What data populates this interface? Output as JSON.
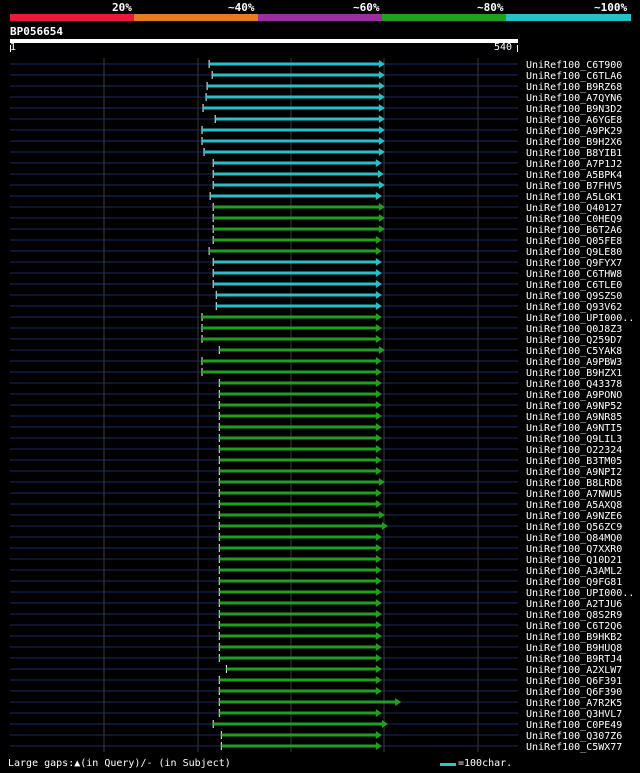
{
  "legend": {
    "labels": [
      "20%",
      "~40%",
      "~60%",
      "~80%",
      "~100%"
    ],
    "colors": [
      "#e8193c",
      "#e87b1e",
      "#9b2fa2",
      "#1fa01f",
      "#27bfc9"
    ]
  },
  "query": {
    "name": "BP056654",
    "start": "1",
    "end": "540"
  },
  "hits": [
    {
      "id": "UniRef100_C6T900",
      "s": 0.392,
      "e": 0.736,
      "c": "#27bfc9"
    },
    {
      "id": "UniRef100_C6TLA6",
      "s": 0.398,
      "e": 0.736,
      "c": "#27bfc9"
    },
    {
      "id": "UniRef100_B9RZ68",
      "s": 0.388,
      "e": 0.736,
      "c": "#27bfc9"
    },
    {
      "id": "UniRef100_A7QYN6",
      "s": 0.386,
      "e": 0.736,
      "c": "#27bfc9"
    },
    {
      "id": "UniRef100_B9N3D2",
      "s": 0.38,
      "e": 0.736,
      "c": "#27bfc9"
    },
    {
      "id": "UniRef100_A6YGE8",
      "s": 0.404,
      "e": 0.736,
      "c": "#27bfc9"
    },
    {
      "id": "UniRef100_A9PK29",
      "s": 0.378,
      "e": 0.736,
      "c": "#27bfc9"
    },
    {
      "id": "UniRef100_B9H2X6",
      "s": 0.378,
      "e": 0.736,
      "c": "#27bfc9"
    },
    {
      "id": "UniRef100_B8YIB1",
      "s": 0.382,
      "e": 0.736,
      "c": "#27bfc9"
    },
    {
      "id": "UniRef100_A7P1J2",
      "s": 0.4,
      "e": 0.73,
      "c": "#27bfc9"
    },
    {
      "id": "UniRef100_A5BPK4",
      "s": 0.4,
      "e": 0.734,
      "c": "#27bfc9"
    },
    {
      "id": "UniRef100_B7FHV5",
      "s": 0.4,
      "e": 0.736,
      "c": "#27bfc9"
    },
    {
      "id": "UniRef100_A5LGK1",
      "s": 0.394,
      "e": 0.73,
      "c": "#27bfc9"
    },
    {
      "id": "UniRef100_Q40127",
      "s": 0.4,
      "e": 0.736,
      "c": "#1fa01f"
    },
    {
      "id": "UniRef100_C0HEQ9",
      "s": 0.4,
      "e": 0.736,
      "c": "#1fa01f"
    },
    {
      "id": "UniRef100_B6T2A6",
      "s": 0.4,
      "e": 0.736,
      "c": "#1fa01f"
    },
    {
      "id": "UniRef100_Q05FE8",
      "s": 0.4,
      "e": 0.73,
      "c": "#1fa01f"
    },
    {
      "id": "UniRef100_Q9LE80",
      "s": 0.392,
      "e": 0.73,
      "c": "#1fa01f"
    },
    {
      "id": "UniRef100_Q9FYX7",
      "s": 0.4,
      "e": 0.73,
      "c": "#27bfc9"
    },
    {
      "id": "UniRef100_C6THW8",
      "s": 0.4,
      "e": 0.73,
      "c": "#27bfc9"
    },
    {
      "id": "UniRef100_C6TLE0",
      "s": 0.4,
      "e": 0.73,
      "c": "#27bfc9"
    },
    {
      "id": "UniRef100_Q9SZS0",
      "s": 0.406,
      "e": 0.73,
      "c": "#27bfc9"
    },
    {
      "id": "UniRef100_Q93V62",
      "s": 0.406,
      "e": 0.73,
      "c": "#27bfc9"
    },
    {
      "id": "UniRef100_UPI000..",
      "s": 0.378,
      "e": 0.73,
      "c": "#1fa01f"
    },
    {
      "id": "UniRef100_Q0J8Z3",
      "s": 0.378,
      "e": 0.73,
      "c": "#1fa01f"
    },
    {
      "id": "UniRef100_Q259D7",
      "s": 0.378,
      "e": 0.73,
      "c": "#1fa01f"
    },
    {
      "id": "UniRef100_C5YAK8",
      "s": 0.412,
      "e": 0.736,
      "c": "#1fa01f"
    },
    {
      "id": "UniRef100_A9PBW3",
      "s": 0.378,
      "e": 0.73,
      "c": "#1fa01f"
    },
    {
      "id": "UniRef100_B9HZX1",
      "s": 0.378,
      "e": 0.73,
      "c": "#1fa01f"
    },
    {
      "id": "UniRef100_Q43378",
      "s": 0.412,
      "e": 0.73,
      "c": "#1fa01f"
    },
    {
      "id": "UniRef100_A9PONO",
      "s": 0.412,
      "e": 0.73,
      "c": "#1fa01f"
    },
    {
      "id": "UniRef100_A9NP52",
      "s": 0.412,
      "e": 0.73,
      "c": "#1fa01f"
    },
    {
      "id": "UniRef100_A9NR85",
      "s": 0.412,
      "e": 0.73,
      "c": "#1fa01f"
    },
    {
      "id": "UniRef100_A9NTI5",
      "s": 0.412,
      "e": 0.73,
      "c": "#1fa01f"
    },
    {
      "id": "UniRef100_Q9LIL3",
      "s": 0.412,
      "e": 0.73,
      "c": "#1fa01f"
    },
    {
      "id": "UniRef100_O22324",
      "s": 0.412,
      "e": 0.73,
      "c": "#1fa01f"
    },
    {
      "id": "UniRef100_B3TM05",
      "s": 0.412,
      "e": 0.73,
      "c": "#1fa01f"
    },
    {
      "id": "UniRef100_A9NPI2",
      "s": 0.412,
      "e": 0.73,
      "c": "#1fa01f"
    },
    {
      "id": "UniRef100_B8LRD8",
      "s": 0.412,
      "e": 0.736,
      "c": "#1fa01f"
    },
    {
      "id": "UniRef100_A7NWU5",
      "s": 0.412,
      "e": 0.73,
      "c": "#1fa01f"
    },
    {
      "id": "UniRef100_A5AXQ8",
      "s": 0.412,
      "e": 0.73,
      "c": "#1fa01f"
    },
    {
      "id": "UniRef100_A9NZE6",
      "s": 0.412,
      "e": 0.736,
      "c": "#1fa01f"
    },
    {
      "id": "UniRef100_Q56ZC9",
      "s": 0.412,
      "e": 0.742,
      "c": "#1fa01f"
    },
    {
      "id": "UniRef100_Q84MQ0",
      "s": 0.412,
      "e": 0.73,
      "c": "#1fa01f"
    },
    {
      "id": "UniRef100_Q7XXR0",
      "s": 0.412,
      "e": 0.73,
      "c": "#1fa01f"
    },
    {
      "id": "UniRef100_Q10D21",
      "s": 0.412,
      "e": 0.73,
      "c": "#1fa01f"
    },
    {
      "id": "UniRef100_A3AML2",
      "s": 0.412,
      "e": 0.73,
      "c": "#1fa01f"
    },
    {
      "id": "UniRef100_Q9FG81",
      "s": 0.412,
      "e": 0.73,
      "c": "#1fa01f"
    },
    {
      "id": "UniRef100_UPI000..",
      "s": 0.412,
      "e": 0.73,
      "c": "#1fa01f"
    },
    {
      "id": "UniRef100_A2TJU6",
      "s": 0.412,
      "e": 0.73,
      "c": "#1fa01f"
    },
    {
      "id": "UniRef100_Q8S2R9",
      "s": 0.412,
      "e": 0.73,
      "c": "#1fa01f"
    },
    {
      "id": "UniRef100_C6T2Q6",
      "s": 0.412,
      "e": 0.73,
      "c": "#1fa01f"
    },
    {
      "id": "UniRef100_B9HKB2",
      "s": 0.412,
      "e": 0.73,
      "c": "#1fa01f"
    },
    {
      "id": "UniRef100_B9HUQ8",
      "s": 0.412,
      "e": 0.73,
      "c": "#1fa01f"
    },
    {
      "id": "UniRef100_B9RTJ4",
      "s": 0.412,
      "e": 0.73,
      "c": "#1fa01f"
    },
    {
      "id": "UniRef100_A2XLW7",
      "s": 0.426,
      "e": 0.73,
      "c": "#1fa01f"
    },
    {
      "id": "UniRef100_Q6F391",
      "s": 0.412,
      "e": 0.73,
      "c": "#1fa01f"
    },
    {
      "id": "UniRef100_Q6F390",
      "s": 0.412,
      "e": 0.73,
      "c": "#1fa01f"
    },
    {
      "id": "UniRef100_A7R2K5",
      "s": 0.412,
      "e": 0.768,
      "c": "#1fa01f"
    },
    {
      "id": "UniRef100_Q3HVL7",
      "s": 0.412,
      "e": 0.73,
      "c": "#1fa01f"
    },
    {
      "id": "UniRef100_C0PE49",
      "s": 0.4,
      "e": 0.742,
      "c": "#1fa01f"
    },
    {
      "id": "UniRef100_Q307Z6",
      "s": 0.416,
      "e": 0.73,
      "c": "#1fa01f"
    },
    {
      "id": "UniRef100_C5WX77",
      "s": 0.416,
      "e": 0.73,
      "c": "#1fa01f"
    }
  ],
  "footer": {
    "gaps_text": "Large gaps:▲(in Query)/- (in Subject)",
    "scale_text": "=100char."
  }
}
